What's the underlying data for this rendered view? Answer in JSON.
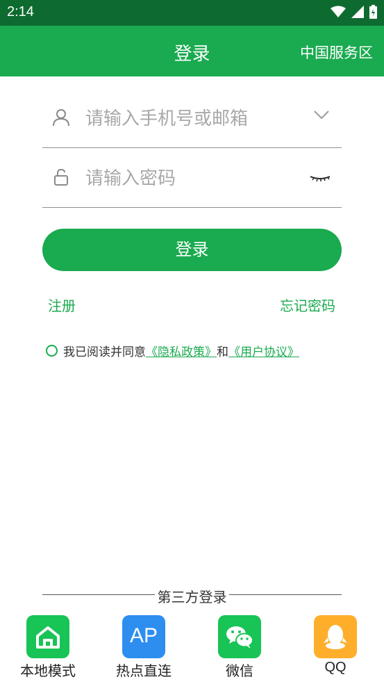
{
  "status": {
    "time": "2:14"
  },
  "header": {
    "title": "登录",
    "region": "中国服务区"
  },
  "form": {
    "account_placeholder": "请输入手机号或邮箱",
    "password_placeholder": "请输入密码",
    "login_label": "登录",
    "register_label": "注册",
    "forgot_label": "忘记密码"
  },
  "agreement": {
    "prefix": "我已阅读并同意",
    "privacy": "《隐私政策》",
    "and": "和",
    "terms": "《用户协议》"
  },
  "third_party": {
    "title": "第三方登录",
    "options": [
      {
        "label": "本地模式",
        "icon": "home-icon",
        "color": "#18c455"
      },
      {
        "label": "热点直连",
        "icon": "ap-icon",
        "icon_text": "AP",
        "color": "#2d8ef0"
      },
      {
        "label": "微信",
        "icon": "wechat-icon",
        "color": "#18c455"
      },
      {
        "label": "QQ",
        "icon": "qq-icon",
        "color": "#ffae2b"
      }
    ]
  },
  "colors": {
    "brand": "#1aaa4f",
    "status_bar": "#0e6b30"
  }
}
